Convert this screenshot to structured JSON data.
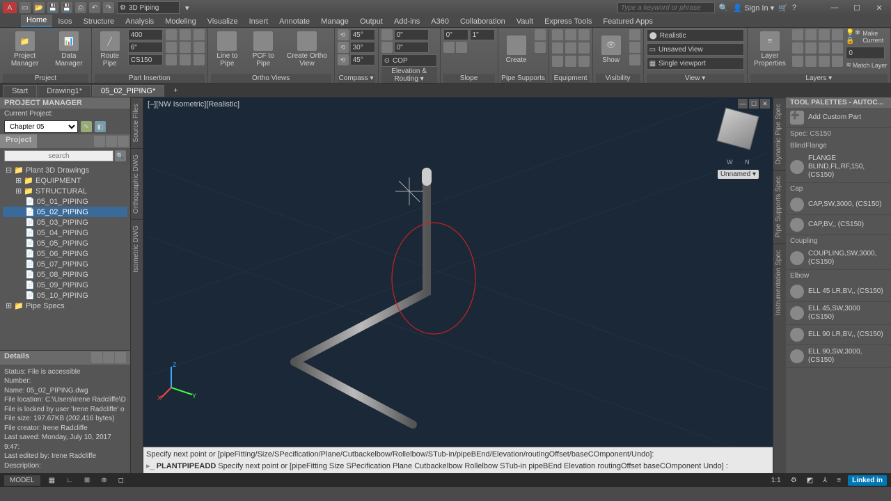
{
  "titlebar": {
    "workspace": "3D Piping",
    "search_placeholder": "Type a keyword or phrase",
    "sign_in": "Sign In"
  },
  "ribbon_tabs": [
    "Home",
    "Isos",
    "Structure",
    "Analysis",
    "Modeling",
    "Visualize",
    "Insert",
    "Annotate",
    "Manage",
    "Output",
    "Add-ins",
    "A360",
    "Collaboration",
    "Vault",
    "Express Tools",
    "Featured Apps"
  ],
  "ribbon_active_tab": "Home",
  "ribbon": {
    "project": {
      "label": "Project",
      "project_manager": "Project\nManager",
      "data_manager": "Data\nManager"
    },
    "part_insertion": {
      "label": "Part Insertion",
      "route_pipe": "Route\nPipe",
      "size1": "400",
      "size2": "6\"",
      "spec": "CS150"
    },
    "ortho": {
      "label": "Ortho Views",
      "line_to_pipe": "Line to\nPipe",
      "pcf_to_pipe": "PCF to\nPipe",
      "create_ortho": "Create\nOrtho View"
    },
    "compass": {
      "label": "Compass ▾",
      "a1": "45°",
      "a2": "30°",
      "a3": "45°"
    },
    "elevation": {
      "label": "Elevation & Routing ▾",
      "e1": "0\"",
      "e2": "0\"",
      "cop": "COP"
    },
    "slope": {
      "label": "Slope",
      "s1": "0\"",
      "s2": "1\""
    },
    "supports": {
      "label": "Pipe Supports",
      "create": "Create"
    },
    "equipment": {
      "label": "Equipment"
    },
    "visibility": {
      "label": "Visibility",
      "show": "Show"
    },
    "view": {
      "label": "View ▾",
      "style": "Realistic",
      "saved": "Unsaved View",
      "viewport": "Single viewport"
    },
    "layers": {
      "label": "Layers ▾",
      "props": "Layer\nProperties",
      "make_current": "Make Current",
      "match": "Match Layer"
    }
  },
  "doc_tabs": [
    {
      "label": "Start",
      "active": false
    },
    {
      "label": "Drawing1*",
      "active": false
    },
    {
      "label": "05_02_PIPING*",
      "active": true
    }
  ],
  "project_manager": {
    "title": "PROJECT MANAGER",
    "current_label": "Current Project:",
    "current_value": "Chapter 05",
    "tab": "Project",
    "search_placeholder": "search",
    "tree_root": "Plant 3D Drawings",
    "tree_folders": [
      "EQUIPMENT",
      "STRUCTURAL"
    ],
    "tree_items": [
      "05_01_PIPING",
      "05_02_PIPING",
      "05_03_PIPING",
      "05_04_PIPING",
      "05_05_PIPING",
      "05_06_PIPING",
      "05_07_PIPING",
      "05_08_PIPING",
      "05_09_PIPING",
      "05_10_PIPING"
    ],
    "tree_selected": "05_02_PIPING",
    "tree_footer": "Pipe Specs"
  },
  "details": {
    "title": "Details",
    "status": "Status: File is accessible",
    "number": "Number:",
    "name": "Name: 05_02_PIPING.dwg",
    "location": "File location: C:\\Users\\Irene Radcliffe\\D",
    "lock": "File is locked by user 'Irene Radcliffe' o",
    "size": "File size: 197.67KB (202,416 bytes)",
    "creator": "File creator: Irene Radcliffe",
    "saved": "Last saved: Monday, July 10, 2017 9:47:",
    "edited": "Last edited by: Irene Radcliffe",
    "description": "Description:"
  },
  "vert_tabs": [
    "Source Files",
    "Orthographic DWG",
    "Isometric DWG"
  ],
  "viewport": {
    "header": "[–][NW Isometric][Realistic]",
    "navcube_label": "Unnamed ▾"
  },
  "cmdline": {
    "line1": "Specify next point or [pipeFitting/Size/SPecification/Plane/Cutbackelbow/Rollelbow/STub-in/pipeBEnd/Elevation/routingOffset/baseCOmponent/Undo]:",
    "cmd": "PLANTPIPEADD",
    "line2": "Specify next point or [pipeFitting Size SPecification Plane Cutbackelbow Rollelbow STub-in pipeBEnd Elevation routingOffset baseCOmponent Undo] :"
  },
  "tool_palette": {
    "title": "TOOL PALETTES - AUTOC...",
    "add_custom": "Add Custom Part",
    "spec": "Spec: CS150",
    "sections": [
      {
        "name": "BlindFlange",
        "items": [
          "FLANGE BLIND,FL,RF,150, (CS150)"
        ]
      },
      {
        "name": "Cap",
        "items": [
          "CAP,SW,3000, (CS150)",
          "CAP,BV,, (CS150)"
        ]
      },
      {
        "name": "Coupling",
        "items": [
          "COUPLING,SW,3000, (CS150)"
        ]
      },
      {
        "name": "Elbow",
        "items": [
          "ELL 45 LR,BV,, (CS150)",
          "ELL 45,SW,3000  (CS150)",
          "ELL 90 LR,BV,, (CS150)",
          "ELL 90,SW,3000, (CS150)"
        ]
      }
    ],
    "right_tabs": [
      "Dynamic Pipe Spec",
      "Pipe Supports Spec",
      "Instrumentation Spec"
    ]
  },
  "statusbar": {
    "model": "MODEL",
    "scale": "1:1"
  }
}
